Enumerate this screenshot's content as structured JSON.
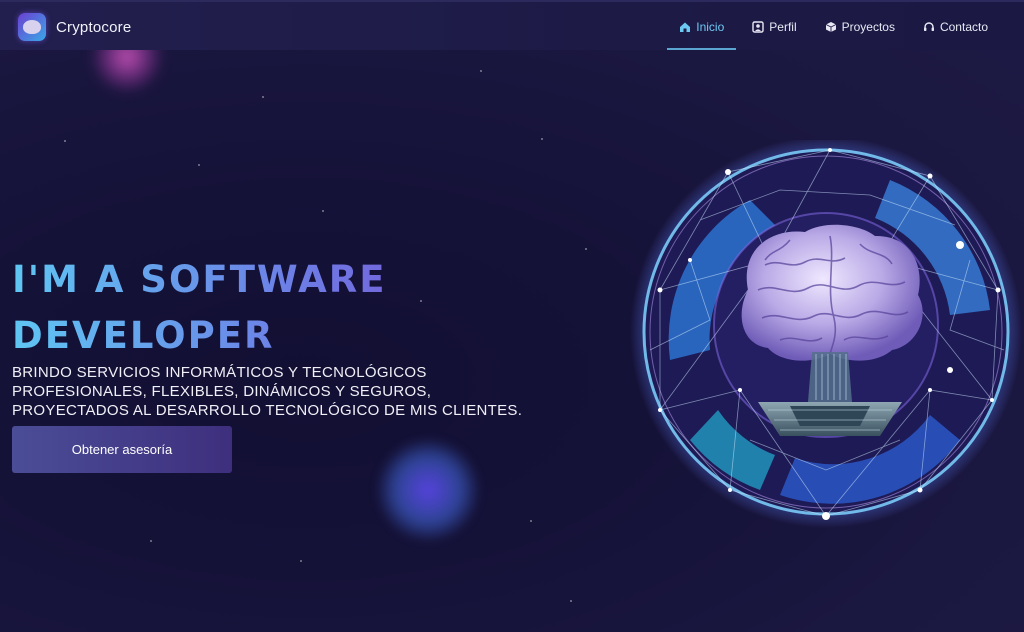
{
  "brand": {
    "name": "Cryptocore",
    "logo_icon": "brain-chip-logo-icon"
  },
  "nav": {
    "items": [
      {
        "label": "Inicio",
        "icon": "home-icon",
        "active": true
      },
      {
        "label": "Perfil",
        "icon": "user-card-icon",
        "active": false
      },
      {
        "label": "Proyectos",
        "icon": "cube-icon",
        "active": false
      },
      {
        "label": "Contacto",
        "icon": "headset-icon",
        "active": false
      }
    ]
  },
  "hero": {
    "title_line1": "I'M A SOFTWARE",
    "title_line2": "DEVELOPER",
    "description_line1": "BRINDO SERVICIOS INFORMÁTICOS Y TECNOLÓGICOS",
    "description_line2": "PROFESIONALES, FLEXIBLES, DINÁMICOS Y SEGUROS,",
    "description_line3": "PROYECTADOS AL DESARROLLO TECNOLÓGICO DE MIS CLIENTES.",
    "cta_label": "Obtener asesoría",
    "illustration": "brain-chip-sphere-illustration"
  },
  "colors": {
    "background": "#161338",
    "accent": "#6cc9f2",
    "title_gradient_start": "#5fc6f3",
    "title_gradient_end": "#7656d6",
    "button": "#45408a"
  }
}
